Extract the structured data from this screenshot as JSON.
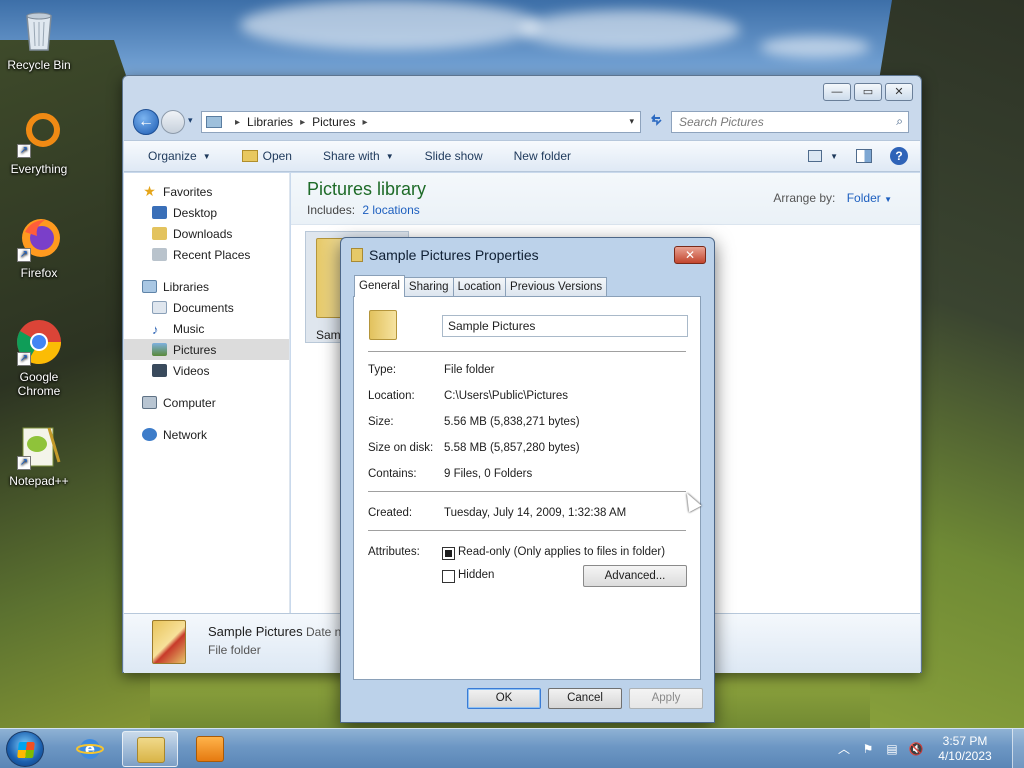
{
  "desktop": {
    "icons": [
      {
        "label": "Recycle Bin",
        "icon": "recycle-bin-icon"
      },
      {
        "label": "Everything",
        "icon": "everything-search-icon"
      },
      {
        "label": "Firefox",
        "icon": "firefox-icon"
      },
      {
        "label": "Google Chrome",
        "icon": "chrome-icon"
      },
      {
        "label": "Notepad++",
        "icon": "notepadpp-icon"
      }
    ]
  },
  "explorer": {
    "controls": {
      "minimize": "—",
      "maximize": "▭",
      "close": "✕"
    },
    "address": {
      "crumbs": [
        "Libraries",
        "Pictures"
      ],
      "separator": "▸",
      "dropdown": "▾"
    },
    "search": {
      "placeholder": "Search Pictures",
      "icon": "search-icon"
    },
    "toolbar": {
      "organize": "Organize",
      "open": "Open",
      "share_with": "Share with",
      "slide_show": "Slide show",
      "new_folder": "New folder",
      "help": "?"
    },
    "nav": {
      "favorites": {
        "label": "Favorites",
        "items": [
          "Desktop",
          "Downloads",
          "Recent Places"
        ]
      },
      "libraries": {
        "label": "Libraries",
        "items": [
          "Documents",
          "Music",
          "Pictures",
          "Videos"
        ],
        "selected": "Pictures"
      },
      "computer": "Computer",
      "network": "Network"
    },
    "content": {
      "title": "Pictures library",
      "includes_label": "Includes:",
      "includes_link": "2 locations",
      "arrange_label": "Arrange by:",
      "arrange_value": "Folder",
      "tile_label": "Samp"
    },
    "details": {
      "name": "Sample Pictures",
      "date_label": "Date n",
      "type": "File folder"
    }
  },
  "dialog": {
    "title": "Sample Pictures Properties",
    "close": "✕",
    "tabs": [
      "General",
      "Sharing",
      "Location",
      "Previous Versions"
    ],
    "active_tab": "General",
    "name_value": "Sample Pictures",
    "fields": {
      "type_label": "Type:",
      "type_value": "File folder",
      "location_label": "Location:",
      "location_value": "C:\\Users\\Public\\Pictures",
      "size_label": "Size:",
      "size_value": "5.56 MB (5,838,271 bytes)",
      "size_on_disk_label": "Size on disk:",
      "size_on_disk_value": "5.58 MB (5,857,280 bytes)",
      "contains_label": "Contains:",
      "contains_value": "9 Files, 0 Folders",
      "created_label": "Created:",
      "created_value": "Tuesday, July 14, 2009, 1:32:38 AM",
      "attributes_label": "Attributes:"
    },
    "attributes": {
      "read_only_label": "Read-only (Only applies to files in folder)",
      "read_only_checked": true,
      "hidden_label": "Hidden",
      "hidden_checked": false,
      "advanced_button": "Advanced..."
    },
    "buttons": {
      "ok": "OK",
      "cancel": "Cancel",
      "apply": "Apply"
    }
  },
  "taskbar": {
    "apps": [
      "internet-explorer-icon",
      "windows-explorer-icon",
      "media-player-icon"
    ],
    "clock_time": "3:57 PM",
    "clock_date": "4/10/2023",
    "tray": {
      "chevron": "︿",
      "flag": "⚑",
      "network": "▤",
      "volume": "🔇"
    }
  }
}
